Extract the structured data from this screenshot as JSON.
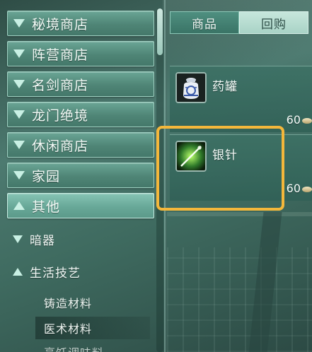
{
  "categories": [
    {
      "label": "秘境商店",
      "expanded": false
    },
    {
      "label": "阵营商店",
      "expanded": false
    },
    {
      "label": "名剑商店",
      "expanded": false
    },
    {
      "label": "龙门绝境",
      "expanded": false
    },
    {
      "label": "休闲商店",
      "expanded": false
    },
    {
      "label": "家园",
      "expanded": false
    },
    {
      "label": "其他",
      "expanded": true
    }
  ],
  "sub_items": [
    {
      "label": "暗器",
      "expanded": false
    },
    {
      "label": "生活技艺",
      "expanded": true
    }
  ],
  "leaf_items": [
    {
      "label": "铸造材料",
      "selected": false
    },
    {
      "label": "医术材料",
      "selected": true
    },
    {
      "label": "烹饪调味料",
      "selected": false
    }
  ],
  "tabs": [
    {
      "label": "商品",
      "active": true
    },
    {
      "label": "回购",
      "active": false
    }
  ],
  "items": [
    {
      "name": "药罐",
      "price": "60",
      "icon": "jar-icon"
    },
    {
      "name": "银针",
      "price": "60",
      "icon": "needle-icon"
    }
  ],
  "highlight_color": "#f4b73b",
  "accent_color": "#4f8f80"
}
